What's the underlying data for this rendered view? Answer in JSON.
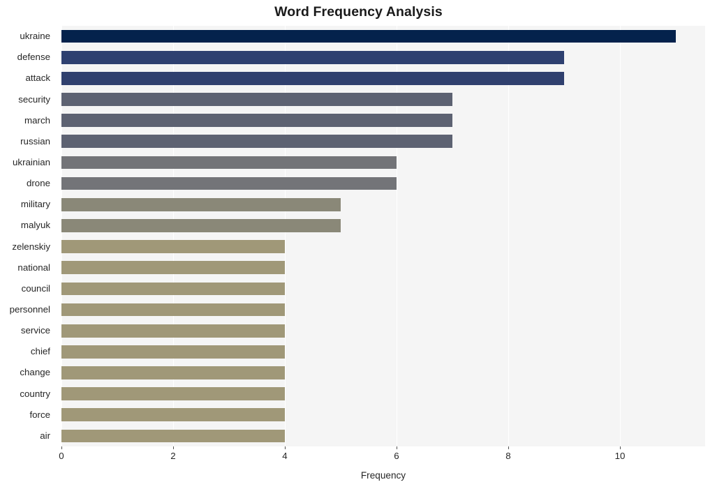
{
  "chart_data": {
    "type": "bar",
    "orientation": "horizontal",
    "title": "Word Frequency Analysis",
    "xlabel": "Frequency",
    "ylabel": "",
    "categories": [
      "ukraine",
      "defense",
      "attack",
      "security",
      "march",
      "russian",
      "ukrainian",
      "drone",
      "military",
      "malyuk",
      "zelenskiy",
      "national",
      "council",
      "personnel",
      "service",
      "chief",
      "change",
      "country",
      "force",
      "air"
    ],
    "values": [
      11,
      9,
      9,
      7,
      7,
      7,
      6,
      6,
      5,
      5,
      4,
      4,
      4,
      4,
      4,
      4,
      4,
      4,
      4,
      4
    ],
    "xlim": [
      0,
      11.525
    ],
    "xticks": [
      0,
      2,
      4,
      6,
      8,
      10
    ],
    "xtick_labels": [
      "0",
      "2",
      "4",
      "6",
      "8",
      "10"
    ],
    "grid": "vertical-white",
    "legend": "none",
    "bar_colors": [
      "#04224c",
      "#2e4070",
      "#30406e",
      "#5d6272",
      "#5d6272",
      "#5d6272",
      "#737478",
      "#737478",
      "#8a8878",
      "#8a8878",
      "#a09878",
      "#a09878",
      "#a09878",
      "#a09878",
      "#a09878",
      "#a09878",
      "#a09878",
      "#a09878",
      "#a09878",
      "#a09878"
    ],
    "plot_background": "#f5f5f5",
    "figure_background": "#ffffff"
  }
}
